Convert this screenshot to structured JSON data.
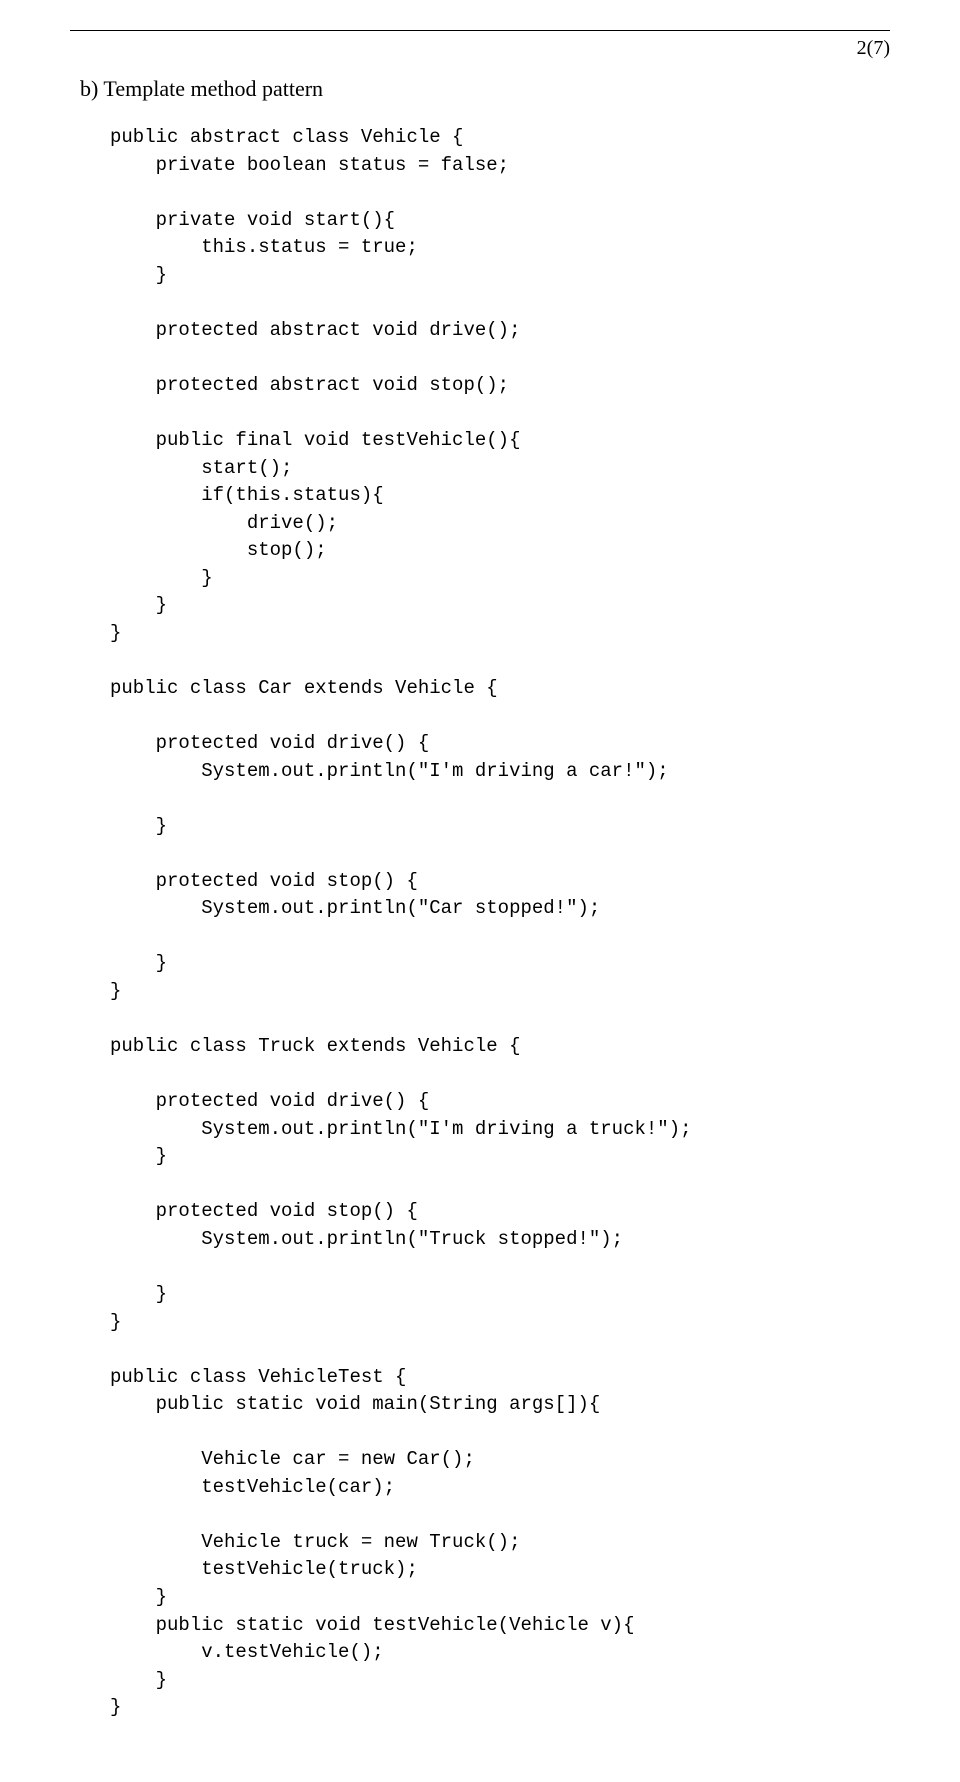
{
  "page_number": "2(7)",
  "section_label": "b) Template method pattern",
  "code": "public abstract class Vehicle {\n    private boolean status = false;\n\n    private void start(){\n        this.status = true;\n    }\n\n    protected abstract void drive();\n\n    protected abstract void stop();\n\n    public final void testVehicle(){\n        start();\n        if(this.status){\n            drive();\n            stop();\n        }\n    }\n}\n\npublic class Car extends Vehicle {\n\n    protected void drive() {\n        System.out.println(\"I'm driving a car!\");\n\n    }\n\n    protected void stop() {\n        System.out.println(\"Car stopped!\");\n\n    }\n}\n\npublic class Truck extends Vehicle {\n\n    protected void drive() {\n        System.out.println(\"I'm driving a truck!\");\n    }\n\n    protected void stop() {\n        System.out.println(\"Truck stopped!\");\n\n    }\n}\n\npublic class VehicleTest {\n    public static void main(String args[]){\n\n        Vehicle car = new Car();\n        testVehicle(car);\n\n        Vehicle truck = new Truck();\n        testVehicle(truck);\n    }\n    public static void testVehicle(Vehicle v){\n        v.testVehicle();\n    }\n}"
}
